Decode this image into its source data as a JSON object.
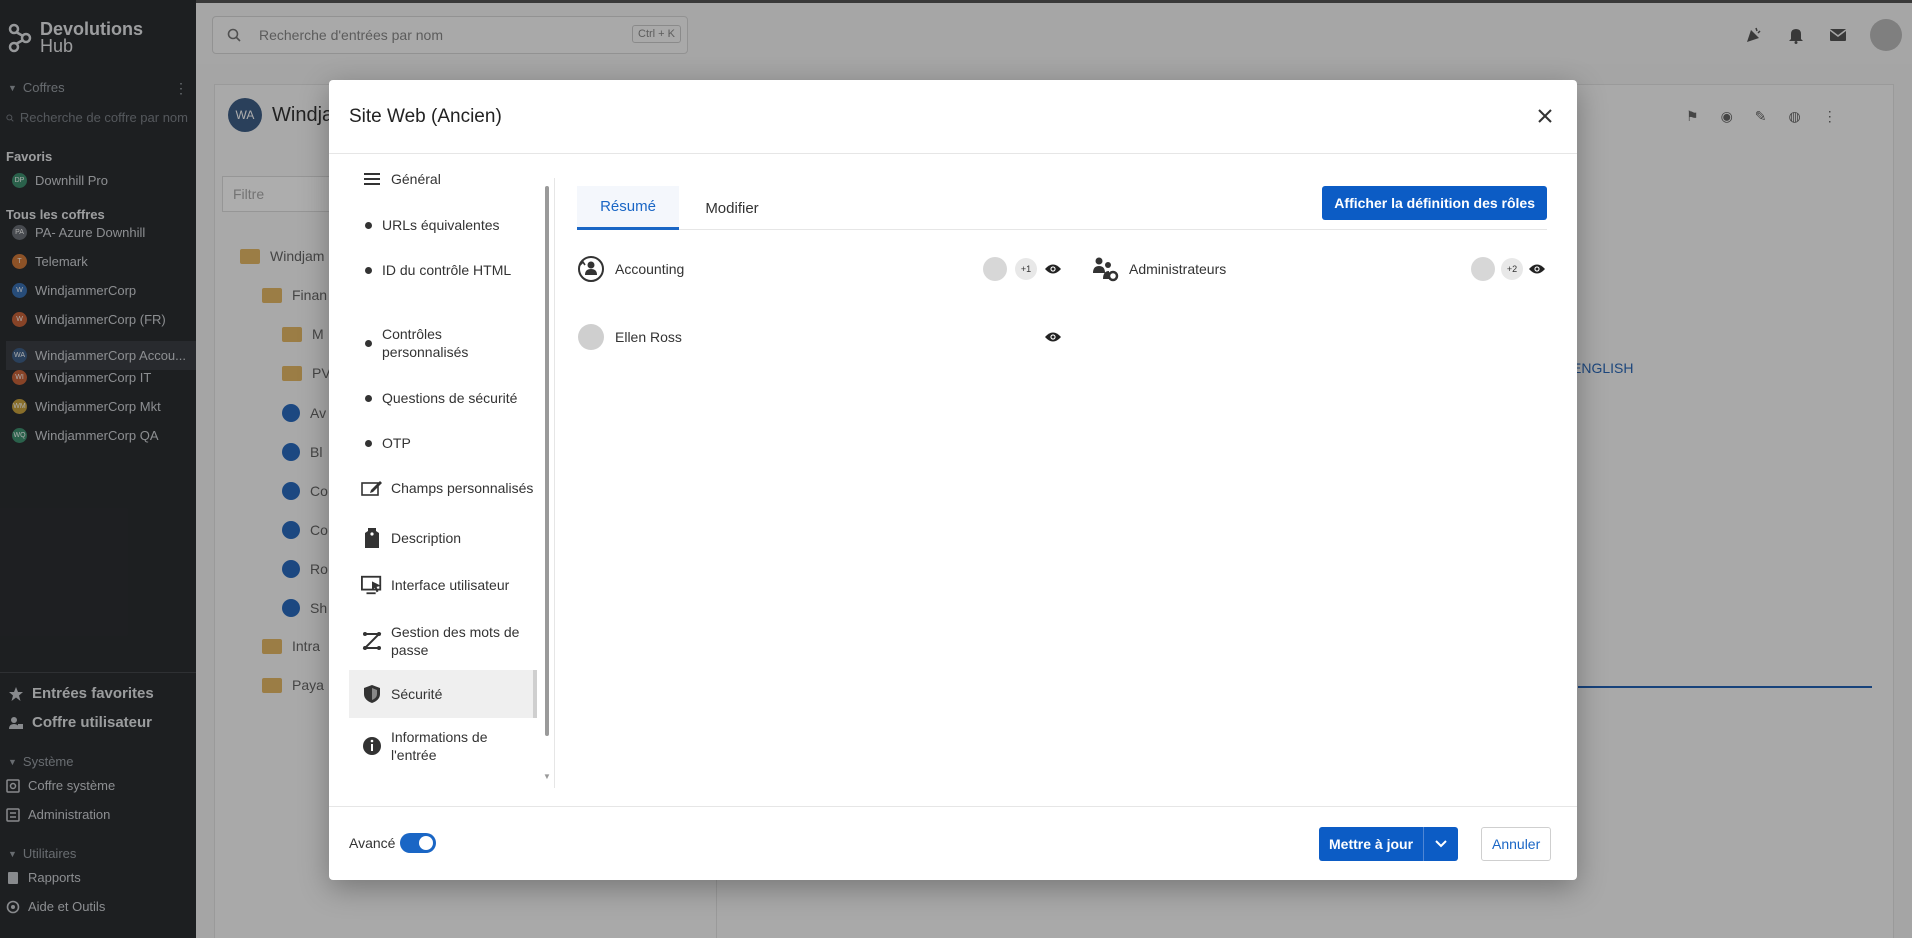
{
  "app": {
    "logo_line1": "Devolutions",
    "logo_line2": "Hub"
  },
  "sidebar": {
    "vaults_section": "Coffres",
    "vault_search_placeholder": "Recherche de coffre par nom",
    "favorites_heading": "Favoris",
    "favorites": [
      {
        "initials": "DP",
        "label": "Downhill Pro",
        "color": "#3f8f6f"
      }
    ],
    "all_vaults_heading": "Tous les coffres",
    "vaults": [
      {
        "initials": "PA",
        "label": "PA- Azure Downhill",
        "color": "#6a6f76"
      },
      {
        "initials": "T",
        "label": "Telemark",
        "color": "#d07a3a"
      },
      {
        "initials": "W",
        "label": "WindjammerCorp",
        "color": "#3a70b3"
      },
      {
        "initials": "W",
        "label": "WindjammerCorp (FR)",
        "color": "#c8643a"
      },
      {
        "initials": "WA",
        "label": "WindjammerCorp Accou...",
        "color": "#3f5f86"
      },
      {
        "initials": "WI",
        "label": "WindjammerCorp IT",
        "color": "#c8643a"
      },
      {
        "initials": "WM",
        "label": "WindjammerCorp Mkt",
        "color": "#c9a23e"
      },
      {
        "initials": "WQ",
        "label": "WindjammerCorp QA",
        "color": "#3f8f6f"
      }
    ],
    "favorite_entries": "Entrées favorites",
    "user_vault": "Coffre utilisateur",
    "system_section": "Système",
    "system_vault": "Coffre système",
    "administration": "Administration",
    "utilities_section": "Utilitaires",
    "reports": "Rapports",
    "help_tools": "Aide et Outils"
  },
  "topbar": {
    "search_placeholder": "Recherche d'entrées par nom",
    "shortcut": "Ctrl + K"
  },
  "background": {
    "vault_initials": "WA",
    "vault_title": "Windja",
    "filter_placeholder": "Filtre",
    "tree": [
      "Windjam",
      "Finan",
      "M",
      "PV",
      "Av",
      "Bl",
      "Co",
      "Co",
      "Ro",
      "Sh",
      "Intra",
      "Paya"
    ],
    "english": "ENGLISH"
  },
  "modal": {
    "title": "Site Web (Ancien)",
    "nav": {
      "general": "Général",
      "equivalent_urls": "URLs équivalentes",
      "html_control_id": "ID du contrôle HTML",
      "custom_controls": "Contrôles personnalisés",
      "security_questions": "Questions de sécurité",
      "otp": "OTP",
      "custom_fields": "Champs personnalisés",
      "description": "Description",
      "user_interface": "Interface utilisateur",
      "password_management": "Gestion des mots de passe",
      "security": "Sécurité",
      "entry_information": "Informations de l'entrée"
    },
    "tabs": {
      "summary": "Résumé",
      "edit": "Modifier"
    },
    "roles_button": "Afficher la définition des rôles",
    "permissions": [
      {
        "name": "Accounting",
        "extra": "+1"
      },
      {
        "name": "Administrateurs",
        "extra": "+2"
      },
      {
        "name": "Ellen Ross",
        "extra": ""
      }
    ],
    "footer": {
      "advanced_label": "Avancé",
      "advanced_on": true,
      "update_button": "Mettre à jour",
      "cancel_button": "Annuler"
    }
  },
  "colors": {
    "accent": "#0c5cc5",
    "sidebar_bg": "#2c2e32"
  }
}
